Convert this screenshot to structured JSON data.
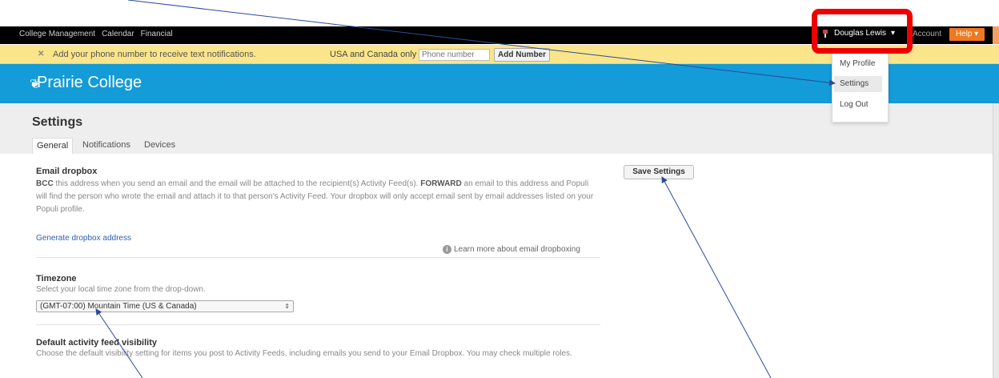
{
  "topnav": {
    "items": [
      "College Management",
      "Calendar",
      "Financial"
    ]
  },
  "user": {
    "name": "Douglas Lewis",
    "chevron": "▾",
    "account_label": "Account",
    "help_label": "Help ▾"
  },
  "notification": {
    "close": "✕",
    "message": "Add your phone number to receive text notifications.",
    "region": "USA and Canada only",
    "phone_placeholder": "Phone number",
    "add_button": "Add Number"
  },
  "brand": {
    "icon": "feather-icon",
    "name": "Prairie College"
  },
  "page": {
    "title": "Settings",
    "tabs": [
      {
        "label": "General",
        "active": true
      },
      {
        "label": "Notifications",
        "active": false
      },
      {
        "label": "Devices",
        "active": false
      }
    ],
    "save_button": "Save Settings"
  },
  "email_dropbox": {
    "heading": "Email dropbox",
    "desc_bcc": "BCC",
    "desc_part1": " this address when you send an email and the email will be attached to the recipient(s) Activity Feed(s). ",
    "desc_forward": "FORWARD",
    "desc_part2": " an email to this address and Populi will find the person who wrote the email and attach it to that person's Activity Feed. Your dropbox will only accept email sent by email addresses listed on your Populi profile.",
    "generate_link": "Generate dropbox address",
    "learn_more": "Learn more about email dropboxing"
  },
  "timezone": {
    "heading": "Timezone",
    "desc": "Select your local time zone from the drop-down.",
    "selected": "(GMT-07:00) Mountain Time (US & Canada)"
  },
  "visibility": {
    "heading": "Default activity feed visibility",
    "desc": "Choose the default visibility setting for items you post to Activity Feeds, including emails you send to your Email Dropbox. You may check multiple roles."
  },
  "user_menu": {
    "items": [
      {
        "label": "My Profile",
        "highlighted": false
      },
      {
        "label": "Settings",
        "highlighted": true
      },
      {
        "label": "Log Out",
        "highlighted": false
      }
    ]
  },
  "annotation": {
    "highlight_color": "#ee0000",
    "arrow_color": "#2c4a9a"
  }
}
